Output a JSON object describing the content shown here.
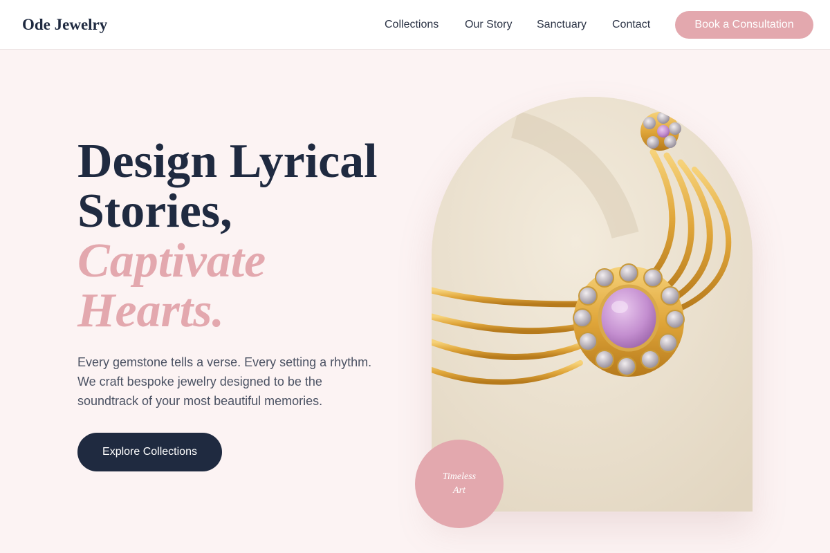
{
  "header": {
    "logo": "Ode Jewelry",
    "nav": [
      {
        "label": "Collections"
      },
      {
        "label": "Our Story"
      },
      {
        "label": "Sanctuary"
      },
      {
        "label": "Contact"
      }
    ],
    "cta_label": "Book a Consultation"
  },
  "hero": {
    "headline_line1": "Design Lyrical",
    "headline_line2": "Stories,",
    "accent_line1": "Captivate",
    "accent_line2": "Hearts.",
    "description": "Every gemstone tells a verse. Every setting a rhythm. We craft bespoke jewelry designed to be the soundtrack of your most beautiful memories.",
    "button_label": "Explore Collections"
  },
  "image": {
    "subject": "gold necklace with lilac gemstone pendant"
  },
  "badge": {
    "line1": "Timeless",
    "line2": "Art"
  },
  "colors": {
    "accent": "#e3a8ae",
    "navy": "#1f2a40",
    "background": "#fcf3f3"
  }
}
